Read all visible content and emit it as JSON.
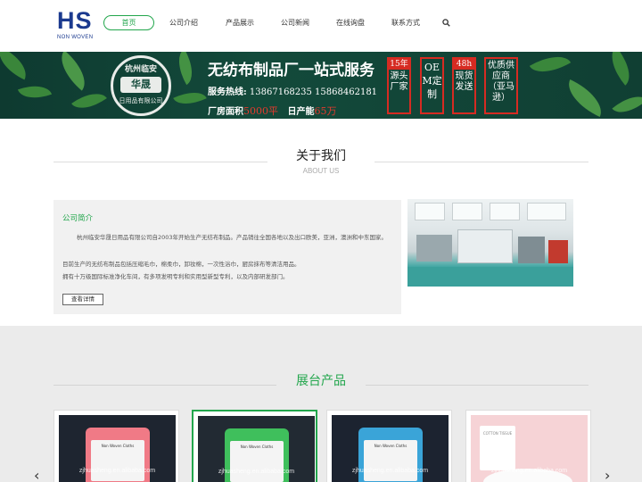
{
  "header": {
    "logo_text": "HS",
    "logo_sub": "NON WOVEN",
    "nav": [
      {
        "label": "首页",
        "active": true
      },
      {
        "label": "公司介绍"
      },
      {
        "label": "产品展示"
      },
      {
        "label": "公司新闻"
      },
      {
        "label": "在线询盘"
      },
      {
        "label": "联系方式"
      }
    ],
    "search_icon": "search-icon"
  },
  "banner": {
    "seal_top": "杭州临安",
    "seal_main": "华晟",
    "seal_bottom": "日用品有限公司",
    "title": "无纺布制品厂一站式服务",
    "hotline_label": "服务热线:",
    "hotline_numbers": "13867168235  15868462181",
    "area_label": "厂房面积",
    "area_value": "5000平",
    "capacity_label": "日产能",
    "capacity_value": "65万",
    "badges": [
      {
        "head": "15年",
        "body": "源头厂家"
      },
      {
        "head": "",
        "body": "OEM定制"
      },
      {
        "head": "48h",
        "body": "现货发送"
      },
      {
        "head": "",
        "body": "优质供应商（亚马逊）"
      }
    ]
  },
  "about": {
    "title": "关于我们",
    "subtitle": "ABOUT US",
    "heading": "公司简介",
    "para1": "杭州临安华晟日用品有限公司自2003年开始生产无纺布制品。产品销往全国各地以及出口欧美，亚洲，澳洲和中东国家。",
    "para2": "目前生产的无纺布制品包括压缩毛巾，棉柔巾，卸妆棉，一次性浴巾，厨房抹布等清洁用品。",
    "para3": "拥有十万级国际标准净化车间，有多项发明专利和实用型新型专利，以及内部研发部门。",
    "detail_button": "查看详情"
  },
  "products": {
    "title": "展台产品",
    "watermark": "zjhuasheng.en.alibaba.com",
    "items": [
      {
        "label_text": "Non Woven Cloths",
        "color": "#f07a86"
      },
      {
        "label_text": "Non Woven Cloths",
        "color": "#3fbf5c"
      },
      {
        "label_text": "Non Woven Cloths",
        "color": "#3aa4d8"
      },
      {
        "label_text": "COTTON TISSUE",
        "color": "#f7c7cd"
      }
    ],
    "prev_arrow": "‹",
    "next_arrow": "›"
  },
  "colors": {
    "accent": "#22a64c",
    "logo": "#1b3a8f",
    "banner_bg": "#134a3b",
    "badge_red": "#d62b22"
  }
}
